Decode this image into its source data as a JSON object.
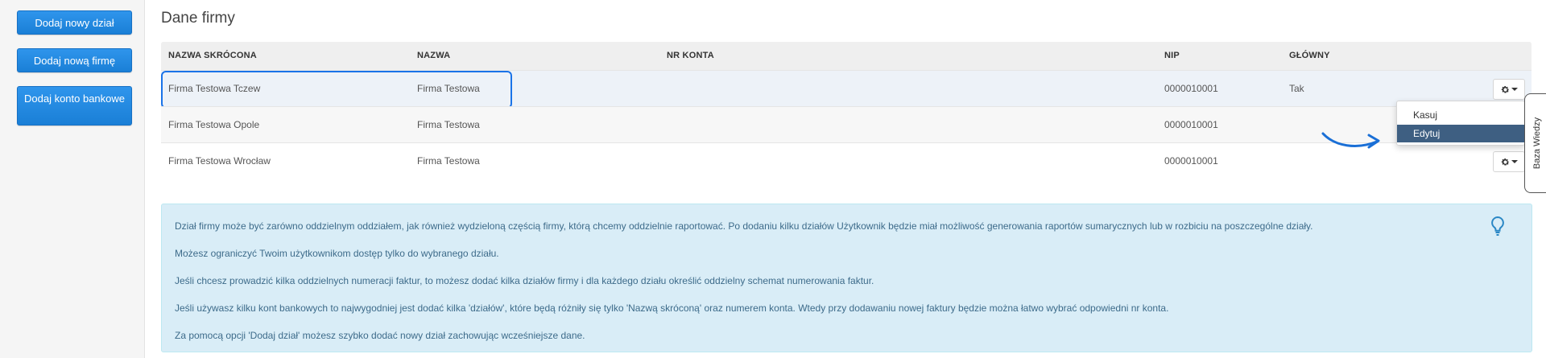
{
  "sidebar": {
    "buttons": [
      "Dodaj nowy dział",
      "Dodaj nową firmę",
      "Dodaj konto bankowe"
    ]
  },
  "page": {
    "title": "Dane firmy"
  },
  "table": {
    "headers": [
      "NAZWA SKRÓCONA",
      "NAZWA",
      "NR KONTA",
      "NIP",
      "GŁÓWNY"
    ],
    "rows": [
      [
        "Firma Testowa Tczew",
        "Firma Testowa",
        "",
        "0000010001",
        "Tak"
      ],
      [
        "Firma Testowa Opole",
        "Firma Testowa",
        "",
        "0000010001",
        ""
      ],
      [
        "Firma Testowa Wrocław",
        "Firma Testowa",
        "",
        "0000010001",
        ""
      ]
    ]
  },
  "dropdown": {
    "items": [
      "Kasuj",
      "Edytuj"
    ],
    "active": "Edytuj"
  },
  "side_tab": {
    "label": "Baza Wiedzy"
  },
  "info": {
    "paragraphs": [
      "Dział firmy może być zarówno oddzielnym oddziałem, jak również wydzieloną częścią firmy, którą chcemy oddzielnie raportować. Po dodaniu kilku działów Użytkownik będzie miał możliwość generowania raportów sumarycznych lub w rozbiciu na poszczególne działy.",
      "Możesz ograniczyć Twoim użytkownikom dostęp tylko do wybranego działu.",
      "Jeśli chcesz prowadzić kilka oddzielnych numeracji faktur, to możesz dodać kilka działów firmy i dla każdego działu określić oddzielny schemat numerowania faktur.",
      "Jeśli używasz kilku kont bankowych to najwygodniej jest dodać kilka 'działów', które będą różniły się tylko 'Nazwą skróconą' oraz numerem konta. Wtedy przy dodawaniu nowej faktury będzie można łatwo wybrać odpowiedni nr konta.",
      "Za pomocą opcji 'Dodaj dział' możesz szybko dodać nowy dział zachowując wcześniejsze dane."
    ]
  },
  "colors": {
    "primary": "#1a7fd6",
    "highlight": "#1a73e8",
    "menu_active": "#3e5f82",
    "info_bg": "#d9edf7"
  }
}
